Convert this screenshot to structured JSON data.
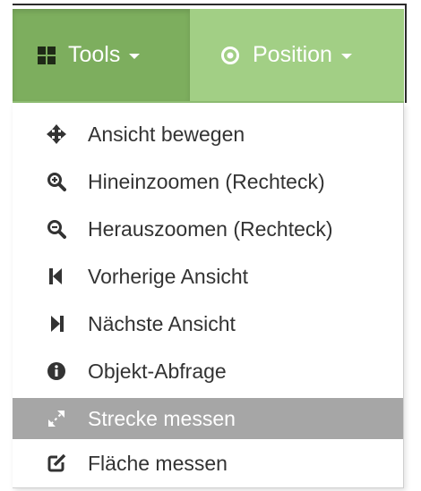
{
  "navbar": {
    "tools": {
      "label": "Tools",
      "icon": "grid-icon"
    },
    "position": {
      "label": "Position",
      "icon": "dot-circle-icon"
    }
  },
  "menu": {
    "items": [
      {
        "label": "Ansicht bewegen",
        "icon": "move-arrows-icon"
      },
      {
        "label": "Hineinzoomen (Rechteck)",
        "icon": "zoom-in-icon"
      },
      {
        "label": "Herauszoomen (Rechteck)",
        "icon": "zoom-out-icon"
      },
      {
        "label": "Vorherige Ansicht",
        "icon": "step-backward-icon"
      },
      {
        "label": "Nächste Ansicht",
        "icon": "step-forward-icon"
      },
      {
        "label": "Objekt-Abfrage",
        "icon": "info-circle-icon"
      },
      {
        "label": "Strecke messen",
        "icon": "resize-diagonal-icon",
        "active": true
      },
      {
        "label": "Fläche messen",
        "icon": "edit-square-icon"
      }
    ]
  },
  "colors": {
    "navbar_bg": "#a2cf85",
    "navbar_active_bg": "#7dae5e",
    "menu_active_bg": "#a6a6a6"
  }
}
